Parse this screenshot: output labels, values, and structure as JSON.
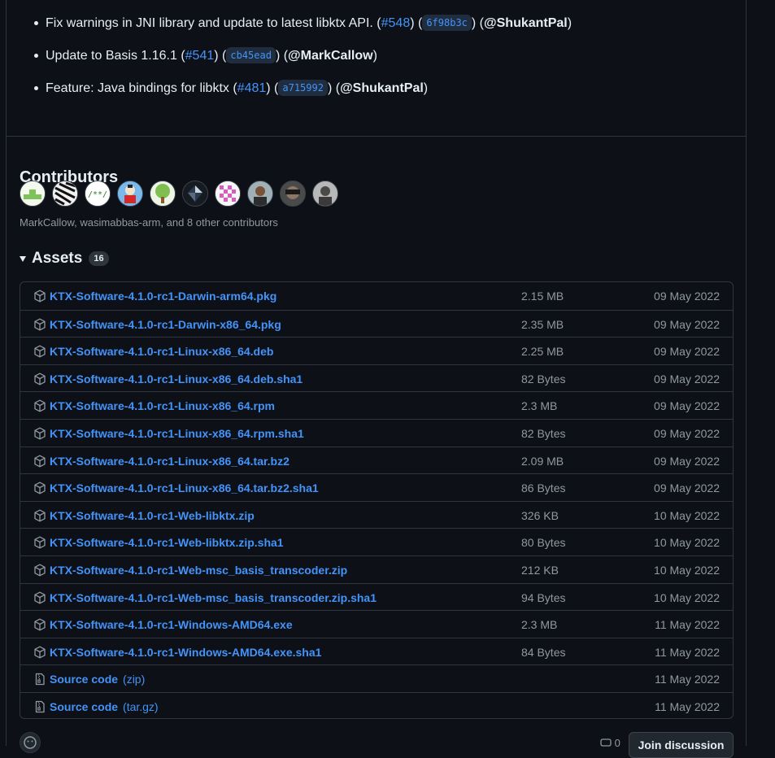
{
  "notes": [
    {
      "text": "Fix warnings in JNI library and update to latest libktx API. (",
      "pr": "#548",
      "sha": "6f98b3c",
      "author": "@ShukantPal"
    },
    {
      "text": "Update to Basis 1.16.1 (",
      "pr": "#541",
      "sha": "cb45ead",
      "author": "@MarkCallow"
    },
    {
      "text": "Feature: Java bindings for libktx (",
      "pr": "#481",
      "sha": "a715992",
      "author": "@ShukantPal"
    }
  ],
  "contributors": {
    "title": "Contributors",
    "summary": "MarkCallow, wasimabbas-arm, and 8 other contributors",
    "avatars": [
      "avatar-1",
      "avatar-2",
      "avatar-3",
      "avatar-4",
      "avatar-5",
      "avatar-6",
      "avatar-7",
      "avatar-8",
      "avatar-9",
      "avatar-10"
    ]
  },
  "assets": {
    "title": "Assets",
    "count": "16",
    "items": [
      {
        "name": "KTX-Software-4.1.0-rc1-Darwin-arm64.pkg",
        "size": "2.15 MB",
        "date": "09 May 2022",
        "icon": "package-icon"
      },
      {
        "name": "KTX-Software-4.1.0-rc1-Darwin-x86_64.pkg",
        "size": "2.35 MB",
        "date": "09 May 2022",
        "icon": "package-icon"
      },
      {
        "name": "KTX-Software-4.1.0-rc1-Linux-x86_64.deb",
        "size": "2.25 MB",
        "date": "09 May 2022",
        "icon": "package-icon"
      },
      {
        "name": "KTX-Software-4.1.0-rc1-Linux-x86_64.deb.sha1",
        "size": "82 Bytes",
        "date": "09 May 2022",
        "icon": "package-icon"
      },
      {
        "name": "KTX-Software-4.1.0-rc1-Linux-x86_64.rpm",
        "size": "2.3 MB",
        "date": "09 May 2022",
        "icon": "package-icon"
      },
      {
        "name": "KTX-Software-4.1.0-rc1-Linux-x86_64.rpm.sha1",
        "size": "82 Bytes",
        "date": "09 May 2022",
        "icon": "package-icon"
      },
      {
        "name": "KTX-Software-4.1.0-rc1-Linux-x86_64.tar.bz2",
        "size": "2.09 MB",
        "date": "09 May 2022",
        "icon": "package-icon"
      },
      {
        "name": "KTX-Software-4.1.0-rc1-Linux-x86_64.tar.bz2.sha1",
        "size": "86 Bytes",
        "date": "09 May 2022",
        "icon": "package-icon"
      },
      {
        "name": "KTX-Software-4.1.0-rc1-Web-libktx.zip",
        "size": "326 KB",
        "date": "10 May 2022",
        "icon": "package-icon"
      },
      {
        "name": "KTX-Software-4.1.0-rc1-Web-libktx.zip.sha1",
        "size": "80 Bytes",
        "date": "10 May 2022",
        "icon": "package-icon"
      },
      {
        "name": "KTX-Software-4.1.0-rc1-Web-msc_basis_transcoder.zip",
        "size": "212 KB",
        "date": "10 May 2022",
        "icon": "package-icon"
      },
      {
        "name": "KTX-Software-4.1.0-rc1-Web-msc_basis_transcoder.zip.sha1",
        "size": "94 Bytes",
        "date": "10 May 2022",
        "icon": "package-icon"
      },
      {
        "name": "KTX-Software-4.1.0-rc1-Windows-AMD64.exe",
        "size": "2.3 MB",
        "date": "11 May 2022",
        "icon": "package-icon"
      },
      {
        "name": "KTX-Software-4.1.0-rc1-Windows-AMD64.exe.sha1",
        "size": "84 Bytes",
        "date": "11 May 2022",
        "icon": "package-icon"
      },
      {
        "name": "Source code",
        "ext": "(zip)",
        "size": "",
        "date": "11 May 2022",
        "icon": "file-zip-icon"
      },
      {
        "name": "Source code",
        "ext": "(tar.gz)",
        "size": "",
        "date": "11 May 2022",
        "icon": "file-zip-icon"
      }
    ]
  },
  "footer": {
    "comment_count": "0",
    "join_label": "Join discussion"
  },
  "colors": {
    "background": "#0d1117",
    "link": "#4493f8",
    "muted": "#9198a1",
    "border": "#30363d"
  }
}
